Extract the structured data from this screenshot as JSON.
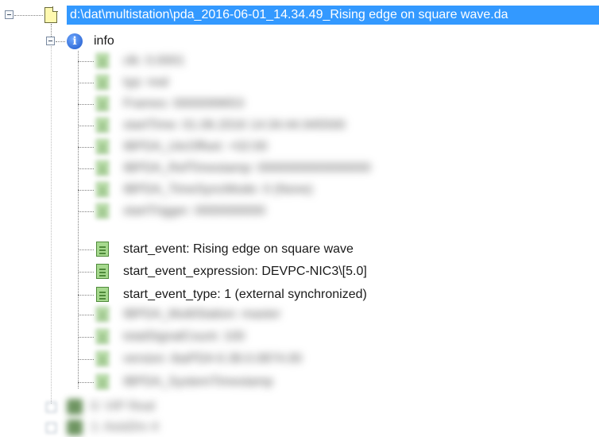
{
  "root": {
    "label": "d:\\dat\\multistation\\pda_2016-06-01_14.34.49_Rising edge on square wave.da"
  },
  "info": {
    "label": "info"
  },
  "items": [
    {
      "text": "clk: 0.0001",
      "blurred": true
    },
    {
      "text": "typ: real",
      "blurred": true
    },
    {
      "text": "Frames: 0000099653",
      "blurred": true
    },
    {
      "text": "startTime: 01.06.2016 14:34:44.945500",
      "blurred": true
    },
    {
      "text": "IBPDA_UtcOffset: +02:00",
      "blurred": true
    },
    {
      "text": "IBPDA_RefTimestamp: 0000000000000000",
      "blurred": true
    },
    {
      "text": "IBPDA_TimeSyncMode: 0 (None)",
      "blurred": true
    },
    {
      "text": "startTrigger: 0000000000",
      "blurred": true
    },
    {
      "text": "start_event: Rising edge on square wave",
      "blurred": false
    },
    {
      "text": "start_event_expression: DEVPC-NIC3\\[5.0]",
      "blurred": false
    },
    {
      "text": "start_event_type: 1 (external synchronized)",
      "blurred": false
    },
    {
      "text": "IBPDA_MultiStation: master",
      "blurred": true
    },
    {
      "text": "totalSignalCount: 100",
      "blurred": true
    },
    {
      "text": "version: ibaPDA 6.38.0.0874.00",
      "blurred": true
    },
    {
      "text": "IBPDA_SystemTimestamp",
      "blurred": true
    }
  ],
  "bottom_items": [
    {
      "text": "0: VIP Real"
    },
    {
      "text": "1: AxisDrv 4"
    }
  ]
}
